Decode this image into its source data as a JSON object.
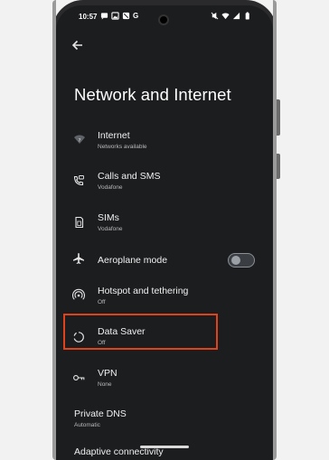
{
  "status_bar": {
    "time": "10:57",
    "left_icons": [
      "message-icon",
      "photo-icon",
      "mute-icon",
      "g-icon"
    ],
    "g_label": "G",
    "right_icons": [
      "mute-icon",
      "wifi-icon",
      "signal-icon",
      "battery-icon"
    ]
  },
  "page": {
    "title": "Network and Internet"
  },
  "items": [
    {
      "title": "Internet",
      "subtitle": "Networks available",
      "icon": "wifi-icon"
    },
    {
      "title": "Calls and SMS",
      "subtitle": "Vodafone",
      "icon": "calls-sms-icon"
    },
    {
      "title": "SIMs",
      "subtitle": "Vodafone",
      "icon": "sim-card-icon"
    },
    {
      "title": "Aeroplane mode",
      "subtitle": "",
      "icon": "airplane-icon",
      "toggle": "off"
    },
    {
      "title": "Hotspot and tethering",
      "subtitle": "Off",
      "icon": "hotspot-icon"
    },
    {
      "title": "Data Saver",
      "subtitle": "Off",
      "icon": "data-saver-icon"
    },
    {
      "title": "VPN",
      "subtitle": "None",
      "icon": "vpn-key-icon"
    },
    {
      "title": "Private DNS",
      "subtitle": "Automatic",
      "icon": ""
    },
    {
      "title": "Adaptive connectivity",
      "subtitle": "",
      "icon": ""
    }
  ],
  "colors": {
    "screen_bg": "#1c1d1f",
    "highlight": "#e0421b",
    "text": "#f0f0f0",
    "subtext": "#b9b9b9"
  }
}
